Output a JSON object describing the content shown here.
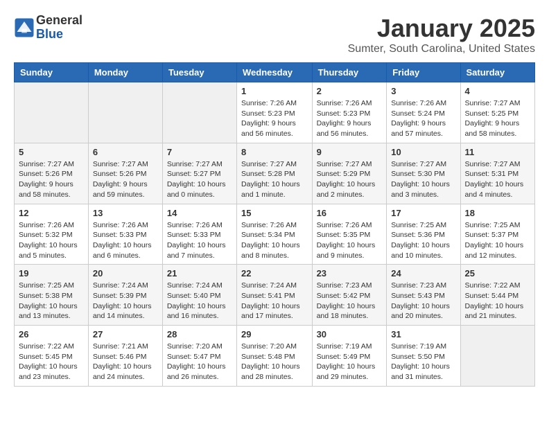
{
  "header": {
    "logo_line1": "General",
    "logo_line2": "Blue",
    "month": "January 2025",
    "location": "Sumter, South Carolina, United States"
  },
  "weekdays": [
    "Sunday",
    "Monday",
    "Tuesday",
    "Wednesday",
    "Thursday",
    "Friday",
    "Saturday"
  ],
  "weeks": [
    [
      {
        "day": "",
        "info": ""
      },
      {
        "day": "",
        "info": ""
      },
      {
        "day": "",
        "info": ""
      },
      {
        "day": "1",
        "info": "Sunrise: 7:26 AM\nSunset: 5:23 PM\nDaylight: 9 hours\nand 56 minutes."
      },
      {
        "day": "2",
        "info": "Sunrise: 7:26 AM\nSunset: 5:23 PM\nDaylight: 9 hours\nand 56 minutes."
      },
      {
        "day": "3",
        "info": "Sunrise: 7:26 AM\nSunset: 5:24 PM\nDaylight: 9 hours\nand 57 minutes."
      },
      {
        "day": "4",
        "info": "Sunrise: 7:27 AM\nSunset: 5:25 PM\nDaylight: 9 hours\nand 58 minutes."
      }
    ],
    [
      {
        "day": "5",
        "info": "Sunrise: 7:27 AM\nSunset: 5:26 PM\nDaylight: 9 hours\nand 58 minutes."
      },
      {
        "day": "6",
        "info": "Sunrise: 7:27 AM\nSunset: 5:26 PM\nDaylight: 9 hours\nand 59 minutes."
      },
      {
        "day": "7",
        "info": "Sunrise: 7:27 AM\nSunset: 5:27 PM\nDaylight: 10 hours\nand 0 minutes."
      },
      {
        "day": "8",
        "info": "Sunrise: 7:27 AM\nSunset: 5:28 PM\nDaylight: 10 hours\nand 1 minute."
      },
      {
        "day": "9",
        "info": "Sunrise: 7:27 AM\nSunset: 5:29 PM\nDaylight: 10 hours\nand 2 minutes."
      },
      {
        "day": "10",
        "info": "Sunrise: 7:27 AM\nSunset: 5:30 PM\nDaylight: 10 hours\nand 3 minutes."
      },
      {
        "day": "11",
        "info": "Sunrise: 7:27 AM\nSunset: 5:31 PM\nDaylight: 10 hours\nand 4 minutes."
      }
    ],
    [
      {
        "day": "12",
        "info": "Sunrise: 7:26 AM\nSunset: 5:32 PM\nDaylight: 10 hours\nand 5 minutes."
      },
      {
        "day": "13",
        "info": "Sunrise: 7:26 AM\nSunset: 5:33 PM\nDaylight: 10 hours\nand 6 minutes."
      },
      {
        "day": "14",
        "info": "Sunrise: 7:26 AM\nSunset: 5:33 PM\nDaylight: 10 hours\nand 7 minutes."
      },
      {
        "day": "15",
        "info": "Sunrise: 7:26 AM\nSunset: 5:34 PM\nDaylight: 10 hours\nand 8 minutes."
      },
      {
        "day": "16",
        "info": "Sunrise: 7:26 AM\nSunset: 5:35 PM\nDaylight: 10 hours\nand 9 minutes."
      },
      {
        "day": "17",
        "info": "Sunrise: 7:25 AM\nSunset: 5:36 PM\nDaylight: 10 hours\nand 10 minutes."
      },
      {
        "day": "18",
        "info": "Sunrise: 7:25 AM\nSunset: 5:37 PM\nDaylight: 10 hours\nand 12 minutes."
      }
    ],
    [
      {
        "day": "19",
        "info": "Sunrise: 7:25 AM\nSunset: 5:38 PM\nDaylight: 10 hours\nand 13 minutes."
      },
      {
        "day": "20",
        "info": "Sunrise: 7:24 AM\nSunset: 5:39 PM\nDaylight: 10 hours\nand 14 minutes."
      },
      {
        "day": "21",
        "info": "Sunrise: 7:24 AM\nSunset: 5:40 PM\nDaylight: 10 hours\nand 16 minutes."
      },
      {
        "day": "22",
        "info": "Sunrise: 7:24 AM\nSunset: 5:41 PM\nDaylight: 10 hours\nand 17 minutes."
      },
      {
        "day": "23",
        "info": "Sunrise: 7:23 AM\nSunset: 5:42 PM\nDaylight: 10 hours\nand 18 minutes."
      },
      {
        "day": "24",
        "info": "Sunrise: 7:23 AM\nSunset: 5:43 PM\nDaylight: 10 hours\nand 20 minutes."
      },
      {
        "day": "25",
        "info": "Sunrise: 7:22 AM\nSunset: 5:44 PM\nDaylight: 10 hours\nand 21 minutes."
      }
    ],
    [
      {
        "day": "26",
        "info": "Sunrise: 7:22 AM\nSunset: 5:45 PM\nDaylight: 10 hours\nand 23 minutes."
      },
      {
        "day": "27",
        "info": "Sunrise: 7:21 AM\nSunset: 5:46 PM\nDaylight: 10 hours\nand 24 minutes."
      },
      {
        "day": "28",
        "info": "Sunrise: 7:20 AM\nSunset: 5:47 PM\nDaylight: 10 hours\nand 26 minutes."
      },
      {
        "day": "29",
        "info": "Sunrise: 7:20 AM\nSunset: 5:48 PM\nDaylight: 10 hours\nand 28 minutes."
      },
      {
        "day": "30",
        "info": "Sunrise: 7:19 AM\nSunset: 5:49 PM\nDaylight: 10 hours\nand 29 minutes."
      },
      {
        "day": "31",
        "info": "Sunrise: 7:19 AM\nSunset: 5:50 PM\nDaylight: 10 hours\nand 31 minutes."
      },
      {
        "day": "",
        "info": ""
      }
    ]
  ]
}
